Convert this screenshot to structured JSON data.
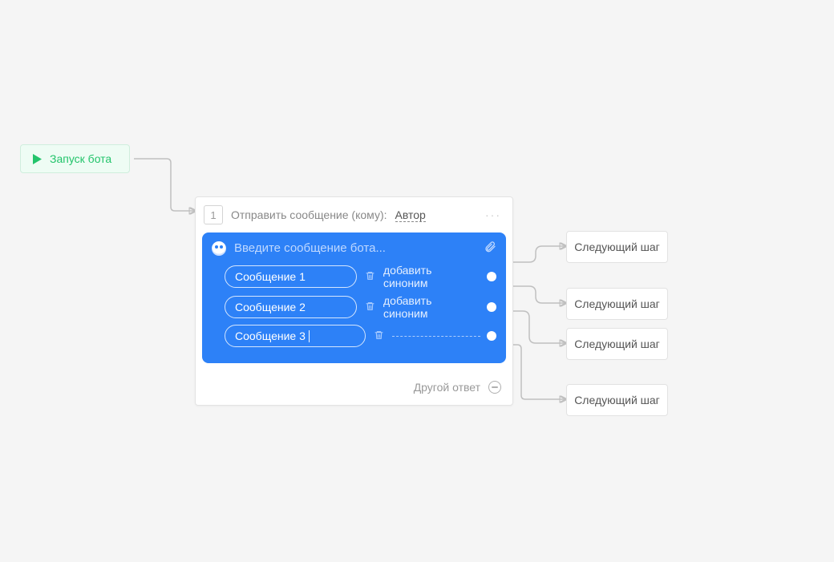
{
  "start": {
    "label": "Запуск бота"
  },
  "card": {
    "step_number": "1",
    "send_label": "Отправить сообщение (кому):",
    "author_label": "Автор",
    "prompt_placeholder": "Введите сообщение бота...",
    "replies": [
      {
        "label": "Сообщение 1",
        "add_synonym": "добавить синоним",
        "editing": false
      },
      {
        "label": "Сообщение 2",
        "add_synonym": "добавить синоним",
        "editing": false
      },
      {
        "label": "Сообщение 3",
        "add_synonym": null,
        "editing": true
      }
    ],
    "other_answer_label": "Другой ответ"
  },
  "next_steps": [
    {
      "label": "Следующий шаг"
    },
    {
      "label": "Следующий шаг"
    },
    {
      "label": "Следующий шаг"
    },
    {
      "label": "Следующий шаг"
    }
  ],
  "colors": {
    "accent_green": "#23c46b",
    "accent_blue": "#2d81f7",
    "connector": "#c0c0c0"
  }
}
